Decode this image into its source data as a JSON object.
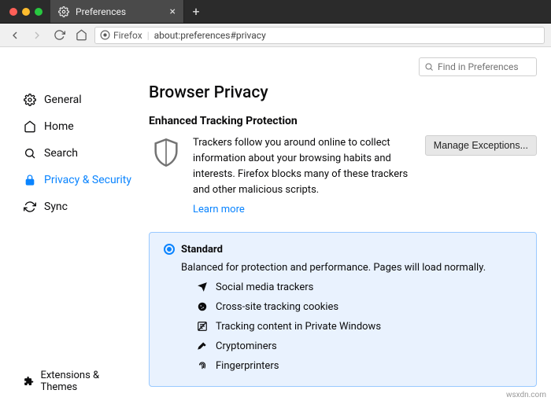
{
  "window": {
    "tab_title": "Preferences",
    "address_identity": "Firefox",
    "address_url": "about:preferences#privacy"
  },
  "search": {
    "placeholder": "Find in Preferences"
  },
  "sidebar": {
    "items": [
      {
        "label": "General"
      },
      {
        "label": "Home"
      },
      {
        "label": "Search"
      },
      {
        "label": "Privacy & Security"
      },
      {
        "label": "Sync"
      }
    ],
    "footer": "Extensions & Themes"
  },
  "content": {
    "h1": "Browser Privacy",
    "h2": "Enhanced Tracking Protection",
    "etp_desc": "Trackers follow you around online to collect information about your browsing habits and interests. Firefox blocks many of these trackers and other malicious scripts.",
    "learn_more": "Learn more",
    "manage_exceptions": "Manage Exceptions...",
    "level": {
      "title": "Standard",
      "desc": "Balanced for protection and performance. Pages will load normally.",
      "items": [
        "Social media trackers",
        "Cross-site tracking cookies",
        "Tracking content in Private Windows",
        "Cryptominers",
        "Fingerprinters"
      ]
    }
  },
  "watermark": "wsxdn.com"
}
